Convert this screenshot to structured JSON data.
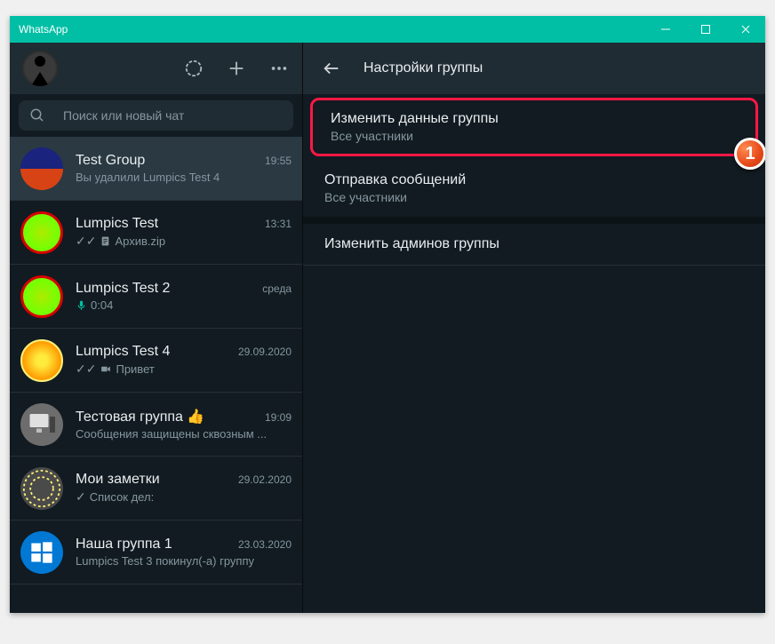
{
  "window": {
    "title": "WhatsApp"
  },
  "search": {
    "placeholder": "Поиск или новый чат"
  },
  "chats": [
    {
      "name": "Test Group",
      "time": "19:55",
      "preview": "Вы удалили Lumpics Test 4",
      "avatar": "city",
      "ticks": "",
      "icon": ""
    },
    {
      "name": "Lumpics Test",
      "time": "13:31",
      "preview": "Архив.zip",
      "avatar": "lime",
      "ticks": "✓✓",
      "icon": "doc"
    },
    {
      "name": "Lumpics Test 2",
      "time": "среда",
      "preview": "0:04",
      "avatar": "lime",
      "ticks": "",
      "icon": "mic"
    },
    {
      "name": "Lumpics Test 4",
      "time": "29.09.2020",
      "preview": "Привет",
      "avatar": "orange",
      "ticks": "✓✓",
      "icon": "video"
    },
    {
      "name": "Тестовая группа 👍",
      "time": "19:09",
      "preview": "Сообщения защищены сквозным ...",
      "avatar": "pc",
      "ticks": "",
      "icon": ""
    },
    {
      "name": "Мои заметки",
      "time": "29.02.2020",
      "preview": "Список дел:",
      "avatar": "notes",
      "ticks": "✓",
      "icon": ""
    },
    {
      "name": "Наша группа 1",
      "time": "23.03.2020",
      "preview": "Lumpics Test 3 покинул(-а) группу",
      "avatar": "win",
      "ticks": "",
      "icon": ""
    }
  ],
  "rightHeader": {
    "title": "Настройки группы"
  },
  "settings": [
    {
      "title": "Изменить данные группы",
      "sub": "Все участники"
    },
    {
      "title": "Отправка сообщений",
      "sub": "Все участники"
    },
    {
      "title": "Изменить админов группы",
      "sub": ""
    }
  ],
  "badge": {
    "number": "1"
  }
}
